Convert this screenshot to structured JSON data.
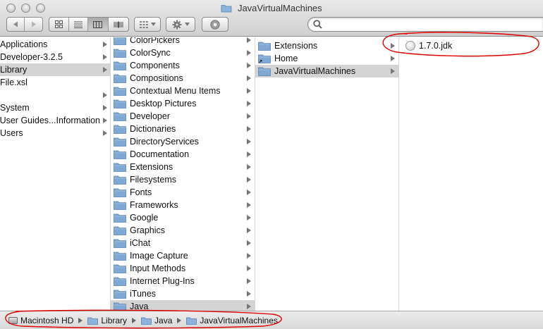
{
  "window": {
    "title": "JavaVirtualMachines"
  },
  "toolbar": {
    "back_icon": "chevron-left-icon",
    "forward_icon": "chevron-right-icon",
    "view_modes": [
      "icon-view",
      "list-view",
      "column-view",
      "coverflow-view"
    ],
    "active_view": "column-view",
    "arrange_icon": "grid-icon",
    "action_icon": "gear-icon",
    "quicklook_icon": "eye-icon",
    "search": {
      "value": "",
      "placeholder": ""
    }
  },
  "columns": {
    "col1": {
      "items": [
        {
          "label": "Applications",
          "arrow": true,
          "selected": false
        },
        {
          "label": "Developer-3.2.5",
          "arrow": true,
          "selected": false
        },
        {
          "label": "Library",
          "arrow": true,
          "selected": true
        },
        {
          "label": "File.xsl",
          "arrow": false,
          "selected": false
        },
        {
          "label": "",
          "arrow": true,
          "selected": false
        },
        {
          "label": "System",
          "arrow": true,
          "selected": false
        },
        {
          "label": "User Guides...Information",
          "arrow": true,
          "selected": false
        },
        {
          "label": "Users",
          "arrow": true,
          "selected": false
        }
      ]
    },
    "col2": {
      "items": [
        {
          "label": "ColorPickers",
          "selected": false
        },
        {
          "label": "ColorSync",
          "selected": false
        },
        {
          "label": "Components",
          "selected": false
        },
        {
          "label": "Compositions",
          "selected": false
        },
        {
          "label": "Contextual Menu Items",
          "selected": false
        },
        {
          "label": "Desktop Pictures",
          "selected": false
        },
        {
          "label": "Developer",
          "selected": false
        },
        {
          "label": "Dictionaries",
          "selected": false
        },
        {
          "label": "DirectoryServices",
          "selected": false
        },
        {
          "label": "Documentation",
          "selected": false
        },
        {
          "label": "Extensions",
          "selected": false
        },
        {
          "label": "Filesystems",
          "selected": false
        },
        {
          "label": "Fonts",
          "selected": false
        },
        {
          "label": "Frameworks",
          "selected": false
        },
        {
          "label": "Google",
          "selected": false
        },
        {
          "label": "Graphics",
          "selected": false
        },
        {
          "label": "iChat",
          "selected": false
        },
        {
          "label": "Image Capture",
          "selected": false
        },
        {
          "label": "Input Methods",
          "selected": false
        },
        {
          "label": "Internet Plug-Ins",
          "selected": false
        },
        {
          "label": "iTunes",
          "selected": false
        },
        {
          "label": "Java",
          "selected": true
        }
      ]
    },
    "col3": {
      "items": [
        {
          "label": "Extensions",
          "selected": false,
          "alias": false
        },
        {
          "label": "Home",
          "selected": false,
          "alias": true
        },
        {
          "label": "JavaVirtualMachines",
          "selected": true,
          "alias": false
        }
      ]
    },
    "col4": {
      "items": [
        {
          "label": "1.7.0.jdk",
          "icon": "jdk-bundle-icon"
        }
      ]
    }
  },
  "pathbar": {
    "items": [
      {
        "label": "Macintosh HD",
        "icon": "hard-drive-icon"
      },
      {
        "label": "Library",
        "icon": "folder-icon"
      },
      {
        "label": "Java",
        "icon": "folder-icon"
      },
      {
        "label": "JavaVirtualMachines",
        "icon": "folder-icon"
      }
    ]
  },
  "colors": {
    "selection": "#d4d4d4",
    "folder": "#7fa8d4",
    "annotation": "#e00000"
  }
}
